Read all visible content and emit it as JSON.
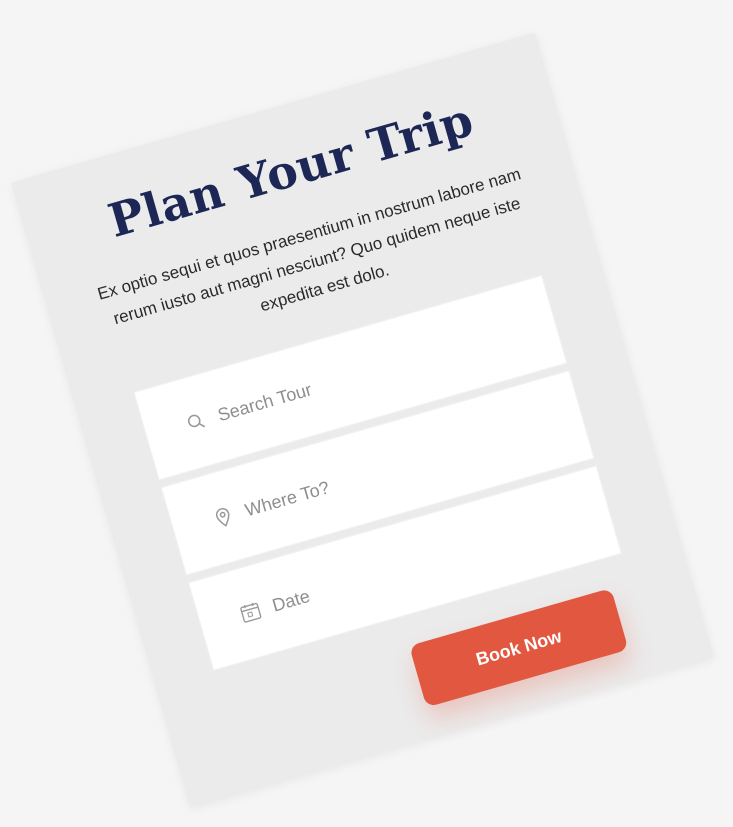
{
  "form": {
    "title": "Plan Your Trip",
    "description": "Ex optio sequi et quos praesentium in nostrum labore nam rerum iusto aut magni nesciunt? Quo quidem neque iste expedita est dolo.",
    "fields": [
      {
        "placeholder": "Search Tour",
        "icon": "search-icon"
      },
      {
        "placeholder": "Where To?",
        "icon": "location-pin-icon"
      },
      {
        "placeholder": "Date",
        "icon": "calendar-icon"
      }
    ],
    "submit_label": "Book Now"
  },
  "colors": {
    "title": "#1d2755",
    "button": "#e2573f",
    "card_background": "#ebebeb",
    "field_background": "#ffffff"
  }
}
